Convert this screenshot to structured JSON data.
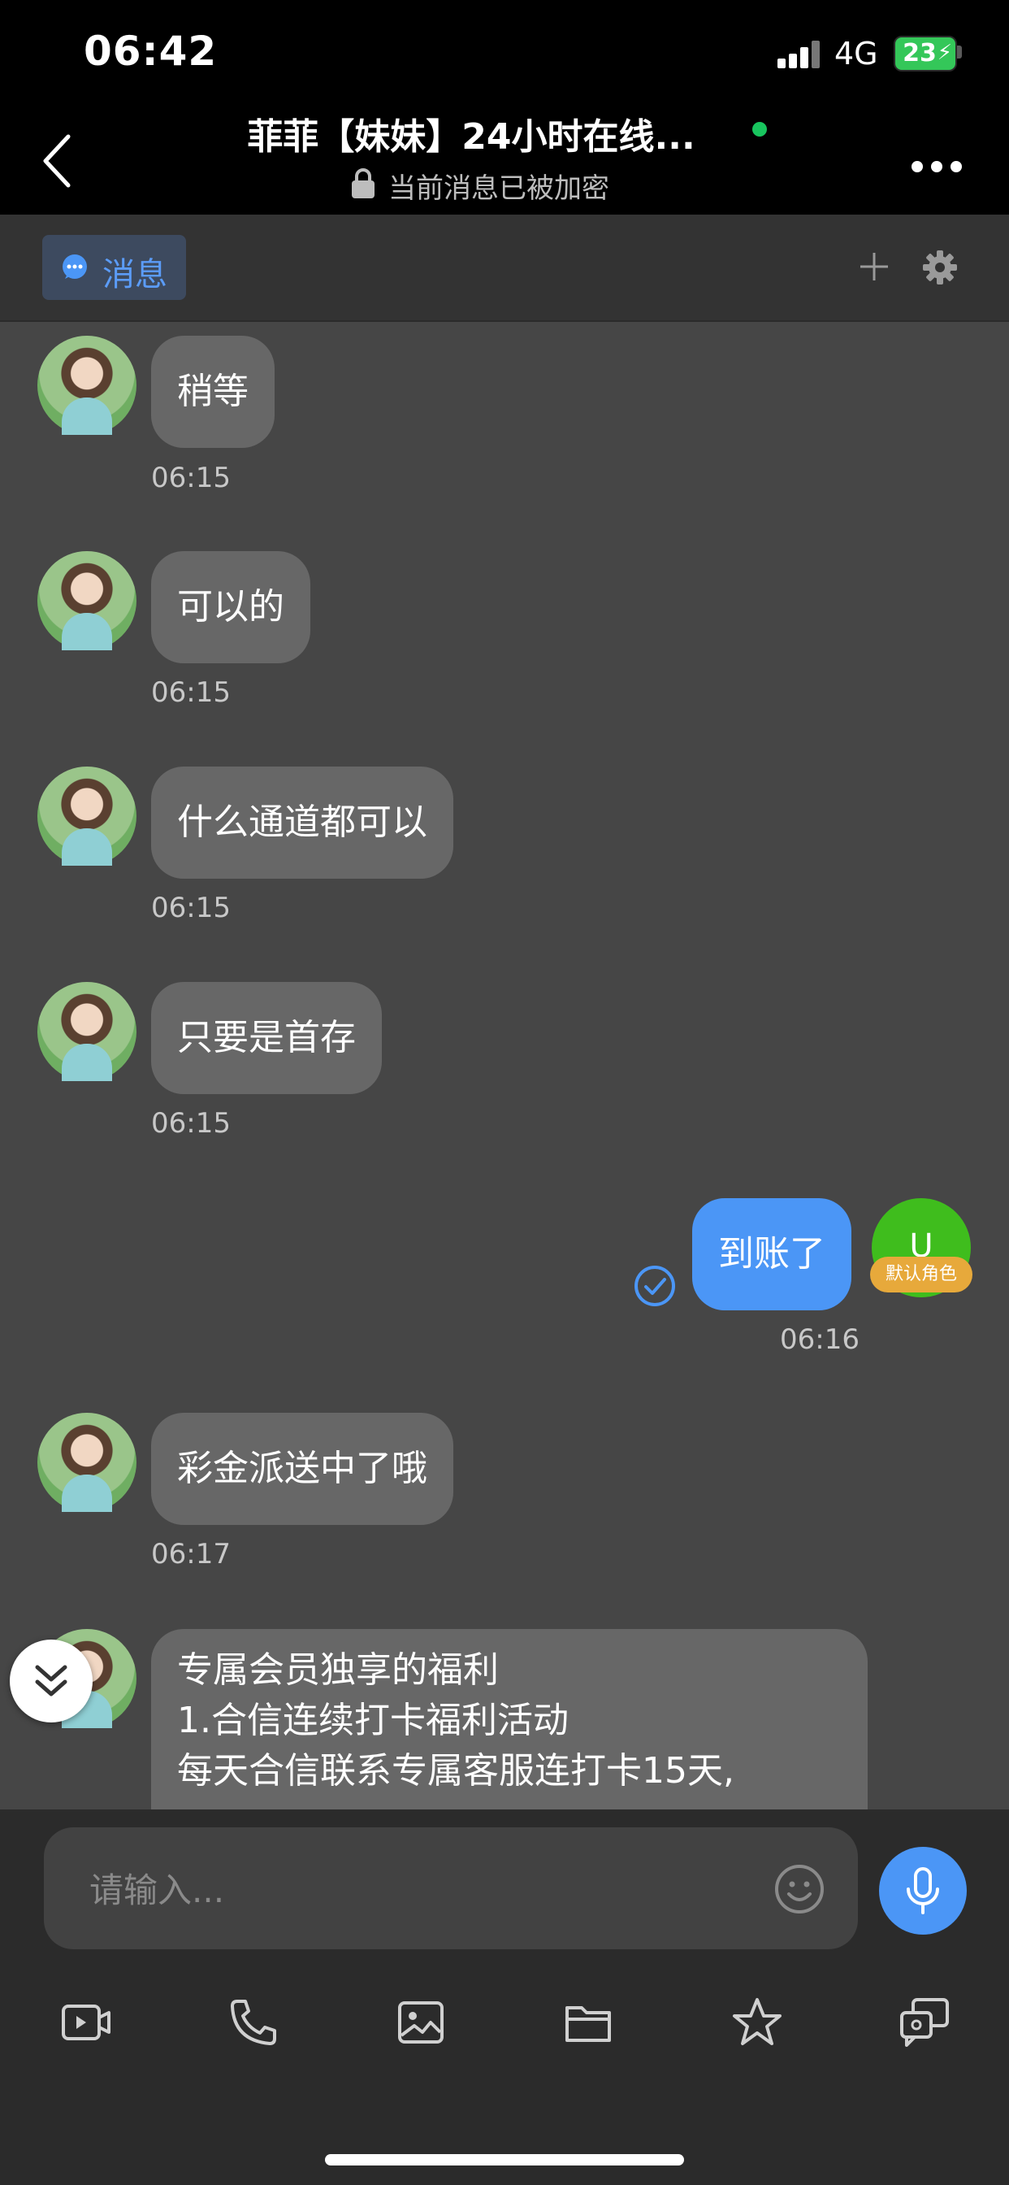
{
  "status_bar": {
    "time": "06:42",
    "network": "4G",
    "battery": "23"
  },
  "header": {
    "title": "菲菲【妹妹】24小时在线...",
    "subtitle": "当前消息已被加密",
    "online_color": "#18c55e"
  },
  "tabs": {
    "messages_label": "消息"
  },
  "messages": [
    {
      "side": "in",
      "text": "稍等",
      "time": "06:15"
    },
    {
      "side": "in",
      "text": "可以的",
      "time": "06:15"
    },
    {
      "side": "in",
      "text": "什么通道都可以",
      "time": "06:15"
    },
    {
      "side": "in",
      "text": "只要是首存",
      "time": "06:15"
    },
    {
      "side": "out",
      "text": "到账了",
      "time": "06:16"
    },
    {
      "side": "in",
      "text": "彩金派送中了哦",
      "time": "06:17"
    }
  ],
  "long_message": {
    "lines": [
      "专属会员独享的福利",
      "1.合信连续打卡福利活动",
      "每天合信联系专属客服连打卡15天,"
    ]
  },
  "user": {
    "avatar_letter": "U",
    "role_badge": "默认角色"
  },
  "input": {
    "placeholder": "请输入..."
  },
  "colors": {
    "accent": "#4b96f6",
    "bubble_in": "#676767",
    "user_avatar": "#3fbd1d",
    "badge": "#e7a93b"
  },
  "toolbar_icons": [
    "video-message-icon",
    "phone-icon",
    "image-icon",
    "folder-icon",
    "star-icon",
    "quick-reply-icon"
  ]
}
